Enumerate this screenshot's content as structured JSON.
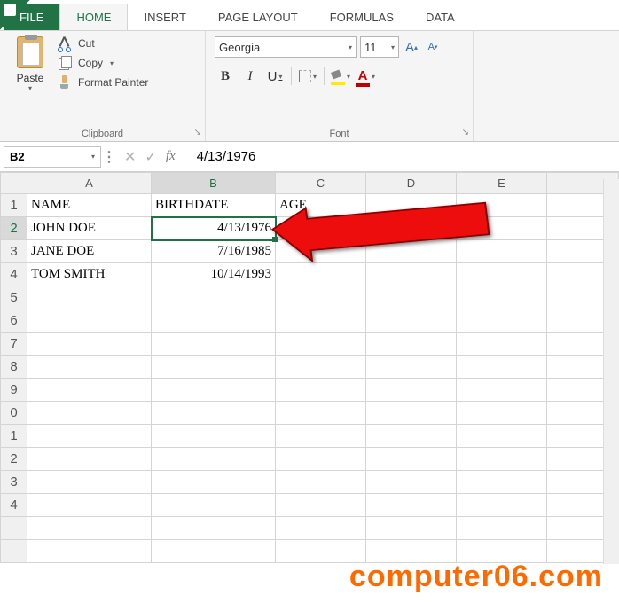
{
  "tabs": {
    "file": "FILE",
    "home": "HOME",
    "insert": "INSERT",
    "page_layout": "PAGE LAYOUT",
    "formulas": "FORMULAS",
    "data": "DATA"
  },
  "clipboard": {
    "paste": "Paste",
    "cut": "Cut",
    "copy": "Copy",
    "format_painter": "Format Painter",
    "group_label": "Clipboard"
  },
  "font": {
    "name": "Georgia",
    "size": "11",
    "bold": "B",
    "italic": "I",
    "underline": "U",
    "fontcolor_glyph": "A",
    "inc_glyph": "A",
    "dec_glyph": "A",
    "group_label": "Font"
  },
  "formula_bar": {
    "name_box": "B2",
    "fx_label": "fx",
    "value": "4/13/1976"
  },
  "columns": [
    "A",
    "B",
    "C",
    "D",
    "E"
  ],
  "row_headers": [
    "1",
    "2",
    "3",
    "4",
    "5",
    "6",
    "7",
    "8",
    "9",
    "0",
    "1",
    "2",
    "3",
    "4"
  ],
  "cells": {
    "A1": "NAME",
    "B1": "BIRTHDATE",
    "C1": "AGE",
    "A2": "JOHN DOE",
    "B2": "4/13/1976",
    "A3": "JANE DOE",
    "B3": "7/16/1985",
    "A4": "TOM SMITH",
    "B4": "10/14/1993"
  },
  "watermark": "computer06.com"
}
